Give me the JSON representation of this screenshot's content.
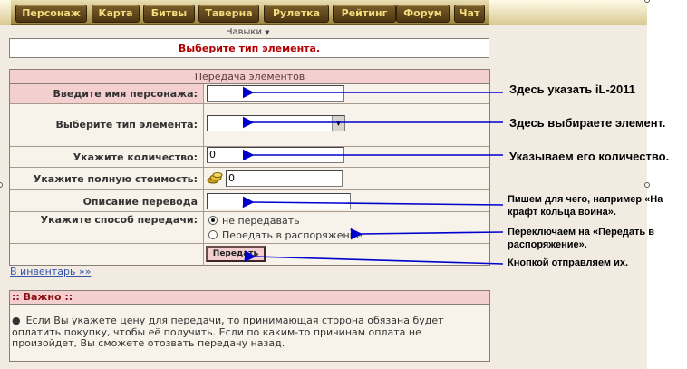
{
  "menu": {
    "items": [
      "Персонаж",
      "Карта",
      "Битвы",
      "Таверна",
      "Рулетка",
      "Рейтинг",
      "Форум",
      "Чат"
    ]
  },
  "skills_label": "Навыки",
  "message": "Выберите тип элемента.",
  "transfer": {
    "title": "Передача элементов",
    "character_label": "Введите имя персонажа:",
    "character_value": "",
    "type_label": "Выберите тип элемента:",
    "type_value": "",
    "quantity_label": "Укажите количество:",
    "quantity_value": "0",
    "price_label": "Укажите полную стоимость:",
    "price_value": "0",
    "description_label": "Описание перевода",
    "description_value": "",
    "method_label": "Укажите способ передачи:",
    "method_options": [
      "не передавать",
      "Передать в распоряжение"
    ],
    "method_selected": 0,
    "send_button": "Передать"
  },
  "inventory_link": "В инвентарь »»",
  "important": {
    "title": ":: Важно ::",
    "text": "Если Вы укажете цену для передачи, то принимающая сторона обязана будет оплатить покупку, чтобы её получить. Если по каким-то причинам оплата не произойдет, Вы сможете отозвать передачу назад."
  },
  "annotations": {
    "character": "Здесь указать iL-2011",
    "type": "Здесь выбираете элемент.",
    "quantity": "Указываем его количество.",
    "description_line1": "Пишем для чего, например «На",
    "description_line2": "крафт кольца воина».",
    "method_line1": "Переключаем на «Передать в",
    "method_line2": "распоряжение».",
    "send": "Кнопкой отправляем их."
  },
  "colors": {
    "arrow": "#0000cc",
    "header_pink": "#f3cfd0",
    "message_red": "#b20000",
    "menu_text": "#f4dd7c"
  }
}
